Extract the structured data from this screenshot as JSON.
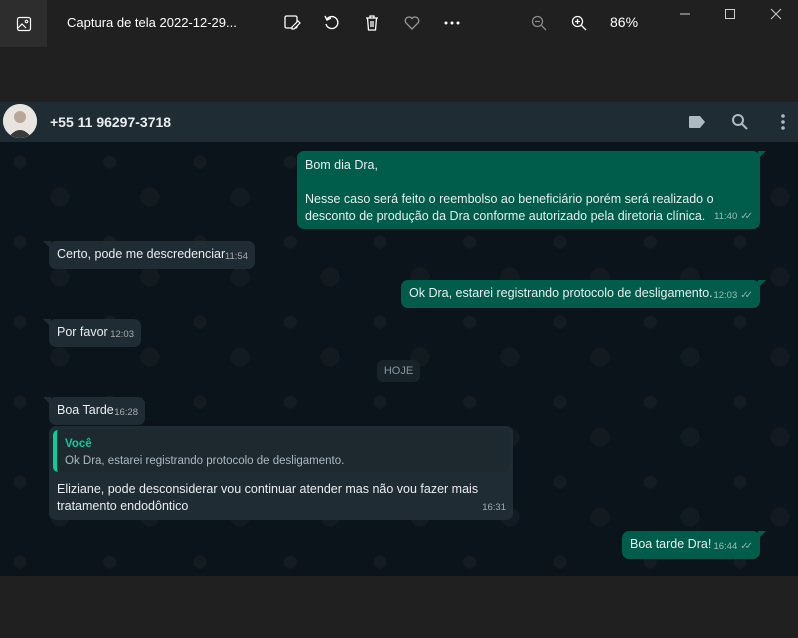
{
  "window": {
    "title": "Captura de tela 2022-12-29...",
    "zoom": "86%",
    "toolbar_icons": [
      "edit-image-icon",
      "rotate-icon",
      "delete-icon",
      "favorite-icon",
      "more-icon",
      "zoom-out-icon",
      "zoom-in-icon"
    ],
    "window_controls": [
      "minimize-icon",
      "maximize-icon",
      "close-icon"
    ]
  },
  "whatsapp": {
    "contact_name": "+55 11 96297-3718",
    "header_icons": [
      "label-icon",
      "search-icon",
      "menu-dots-icon"
    ],
    "day_separator": "HOJE",
    "messages": [
      {
        "direction": "out",
        "text": "Bom dia Dra,\n\nNesse caso será feito o reembolso ao beneficiário porém será realizado o desconto de produção da Dra conforme autorizado pela diretoria clínica.",
        "time": "11:40"
      },
      {
        "direction": "in",
        "text": "Certo, pode me descredenciar",
        "time": "11:54"
      },
      {
        "direction": "out",
        "text": "Ok Dra, estarei registrando protocolo de desligamento.",
        "time": "12:03"
      },
      {
        "direction": "in",
        "text": "Por favor",
        "time": "12:03"
      },
      {
        "direction": "in",
        "text": "Boa Tarde",
        "time": "16:28"
      },
      {
        "direction": "in",
        "quote_author": "Você",
        "quote_text": "Ok Dra, estarei registrando protocolo de desligamento.",
        "text": "Eliziane, pode desconsiderar vou continuar atender mas não vou fazer mais tratamento endodôntico",
        "time": "16:31"
      },
      {
        "direction": "out",
        "text": "Boa tarde Dra!",
        "time": "16:44"
      }
    ]
  },
  "colors": {
    "chat_bg": "#0b141a",
    "incoming": "#202c33",
    "outgoing": "#005c4b",
    "quote_accent": "#06cf9c"
  }
}
